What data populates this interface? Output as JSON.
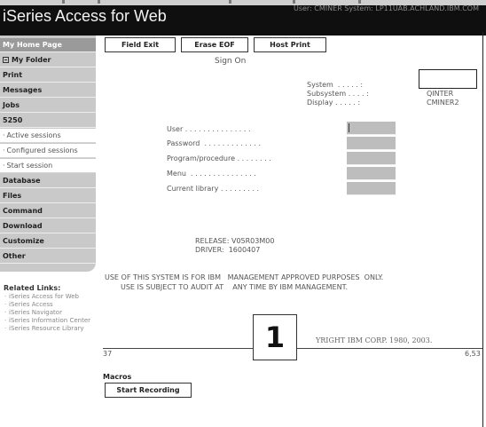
{
  "header": {
    "title": "iSeries Access for Web",
    "userline": "User: CMINER   System: LP11UAB.ACHLAND.IBM.COM"
  },
  "sidebar": {
    "items": [
      {
        "label": "My Home Page",
        "style": "home"
      },
      {
        "label": "My Folder",
        "style": "folder",
        "icon": "folder-square-icon"
      },
      {
        "label": "Print"
      },
      {
        "label": "Messages"
      },
      {
        "label": "Jobs"
      },
      {
        "label": "5250"
      },
      {
        "label": "Active sessions",
        "style": "sub"
      },
      {
        "label": "Configured sessions",
        "style": "sub"
      },
      {
        "label": "Start session",
        "style": "sub"
      },
      {
        "label": "Database"
      },
      {
        "label": "Files"
      },
      {
        "label": "Command"
      },
      {
        "label": "Download"
      },
      {
        "label": "Customize"
      },
      {
        "label": "Other"
      }
    ],
    "related_title": "Related Links:",
    "related_links": [
      "iSeries Access for Web",
      "iSeries Access",
      "iSeries Navigator",
      "iSeries Information Center",
      "iSeries Resource Library"
    ]
  },
  "toolbar": {
    "field_exit": "Field Exit",
    "erase_eof": "Erase EOF",
    "host_print": "Host Print"
  },
  "screen": {
    "heading": "Sign On",
    "system_label": "System  . . . . . :",
    "subsystem_label": "Subsystem . . . . :",
    "subsystem_value": "QINTER",
    "display_label": "Display . . . . . :",
    "display_value": "CMINER2",
    "fields": [
      {
        "label": "User . . . . . . . . . . . . . . ."
      },
      {
        "label": "Password  . . . . . . . . . . . . ."
      },
      {
        "label": "Program/procedure . . . . . . . ."
      },
      {
        "label": "Menu  . . . . . . . . . . . . . . ."
      },
      {
        "label": "Current library . . . . . . . . ."
      }
    ],
    "release": "RELEASE: V05R03M00",
    "driver": "DRIVER:  1600407",
    "notice_line1": "USE OF THIS SYSTEM IS FOR IBM   MANAGEMENT APPROVED PURPOSES  ONLY.",
    "notice_line2": "USE IS SUBJECT TO AUDIT AT    ANY TIME BY IBM MANAGEMENT.",
    "copyright": "YRIGHT IBM CORP. 1980, 2003.",
    "status_left": "37",
    "status_right": "6,53",
    "callout": "1"
  },
  "macros": {
    "title": "Macros",
    "start_recording": "Start Recording"
  }
}
